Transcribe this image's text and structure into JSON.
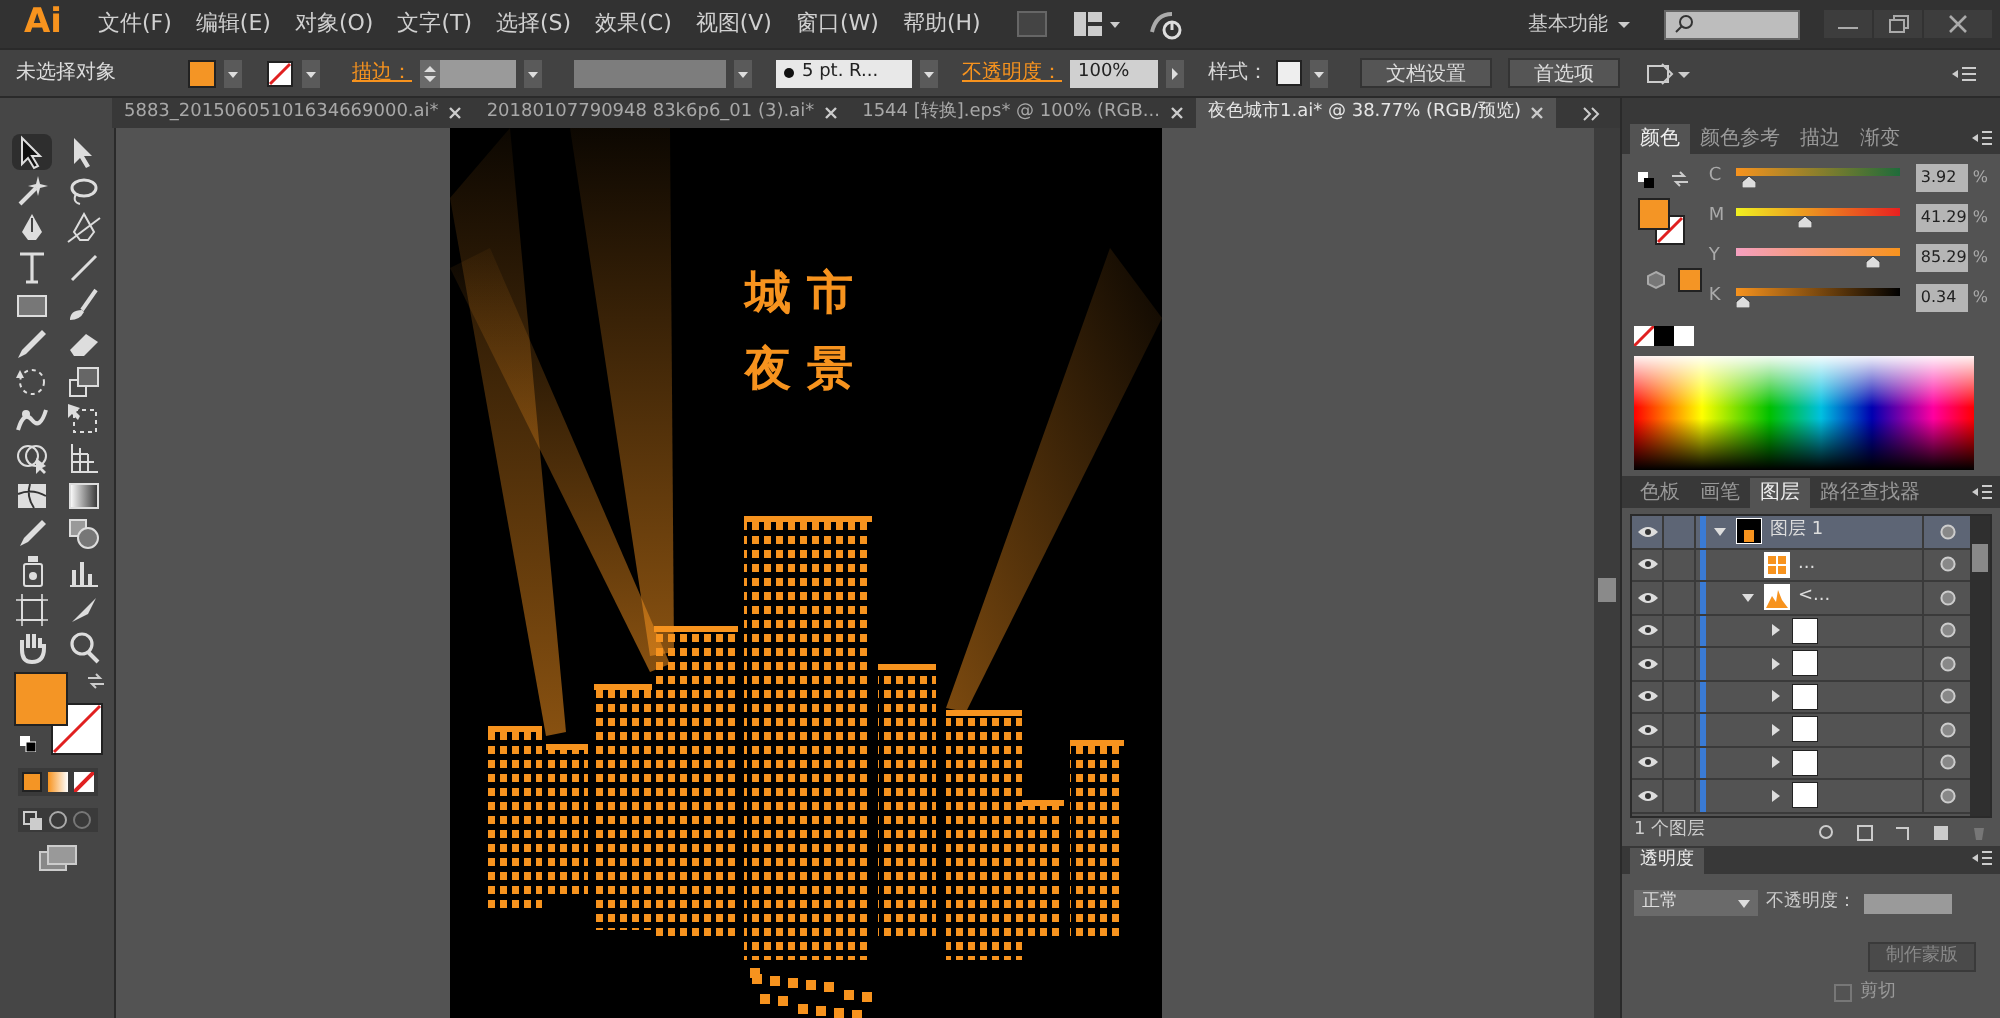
{
  "app": {
    "logo": "Ai",
    "menus": [
      "文件(F)",
      "编辑(E)",
      "对象(O)",
      "文字(T)",
      "选择(S)",
      "效果(C)",
      "视图(V)",
      "窗口(W)",
      "帮助(H)"
    ],
    "workspace": "基本功能"
  },
  "swatches": {
    "stroke_none": true
  },
  "control_bar": {
    "selection": "未选择对象",
    "stroke_label": "描边：",
    "brush": "5 pt. R...",
    "opacity_label": "不透明度：",
    "opacity": "100%",
    "style_label": "样式：",
    "buttons": [
      "文档设置",
      "首选项"
    ]
  },
  "doc_tabs": [
    {
      "label": "5883_20150605101634669000.ai*",
      "selected": false
    },
    {
      "label": "20180107790948 83k6p6_01 (3).ai*",
      "selected": false
    },
    {
      "label": "1544 [转换].eps* @ 100% (RGB...",
      "selected": false
    },
    {
      "label": "夜色城市1.ai* @ 38.77% (RGB/预览)",
      "selected": true
    }
  ],
  "tools": [
    {
      "selected": true
    },
    {
      "selected": false
    },
    {
      "selected": false
    },
    {
      "selected": false
    },
    {
      "selected": false
    },
    {
      "selected": false
    },
    {
      "selected": false
    },
    {
      "selected": false
    },
    {
      "selected": false
    },
    {
      "selected": false
    },
    {
      "selected": false
    },
    {
      "selected": false
    },
    {
      "selected": false
    },
    {
      "selected": false
    },
    {
      "selected": false
    },
    {
      "selected": false
    },
    {
      "selected": false
    },
    {
      "selected": false
    },
    {
      "selected": false
    },
    {
      "selected": false
    },
    {
      "selected": false
    },
    {
      "selected": false
    },
    {
      "selected": false
    },
    {
      "selected": false
    },
    {
      "selected": false
    },
    {
      "selected": false
    },
    {
      "selected": false
    },
    {
      "selected": false
    }
  ],
  "artwork": {
    "title_lines": [
      "城市",
      "夜景"
    ]
  },
  "color_panel": {
    "tabs": [
      {
        "label": "颜色",
        "selected": true
      },
      {
        "label": "颜色参考",
        "selected": false
      },
      {
        "label": "描边",
        "selected": false
      },
      {
        "label": "渐变",
        "selected": false
      }
    ],
    "channels": [
      {
        "name": "C",
        "value": "3.92",
        "unit": "%",
        "level": 0.04
      },
      {
        "name": "M",
        "value": "41.29",
        "unit": "%",
        "level": 0.41
      },
      {
        "name": "Y",
        "value": "85.29",
        "unit": "%",
        "level": 0.85
      },
      {
        "name": "K",
        "value": "0.34",
        "unit": "%",
        "level": 0.0
      }
    ]
  },
  "layers_panel": {
    "tabs": [
      {
        "label": "色板",
        "selected": false
      },
      {
        "label": "画笔",
        "selected": false
      },
      {
        "label": "图层",
        "selected": true
      },
      {
        "label": "路径查找器",
        "selected": false
      }
    ],
    "layers": [
      {
        "name": "图层 1",
        "expanded": true,
        "selected": true,
        "children": [
          {
            "name": "..."
          },
          {
            "name": "<...",
            "expanded": true,
            "children": [
              {
                "expanded": false
              },
              {
                "expanded": false
              },
              {
                "expanded": false
              },
              {
                "expanded": false
              },
              {
                "expanded": false
              },
              {
                "expanded": false
              }
            ]
          }
        ]
      }
    ],
    "footer": "1 个图层"
  },
  "transparency_panel": {
    "tab": "透明度",
    "blend_mode": "正常",
    "opacity_label": "不透明度：",
    "buttons": [
      "制作蒙版"
    ],
    "clip_label": "剪切",
    "clip_checked": false
  }
}
